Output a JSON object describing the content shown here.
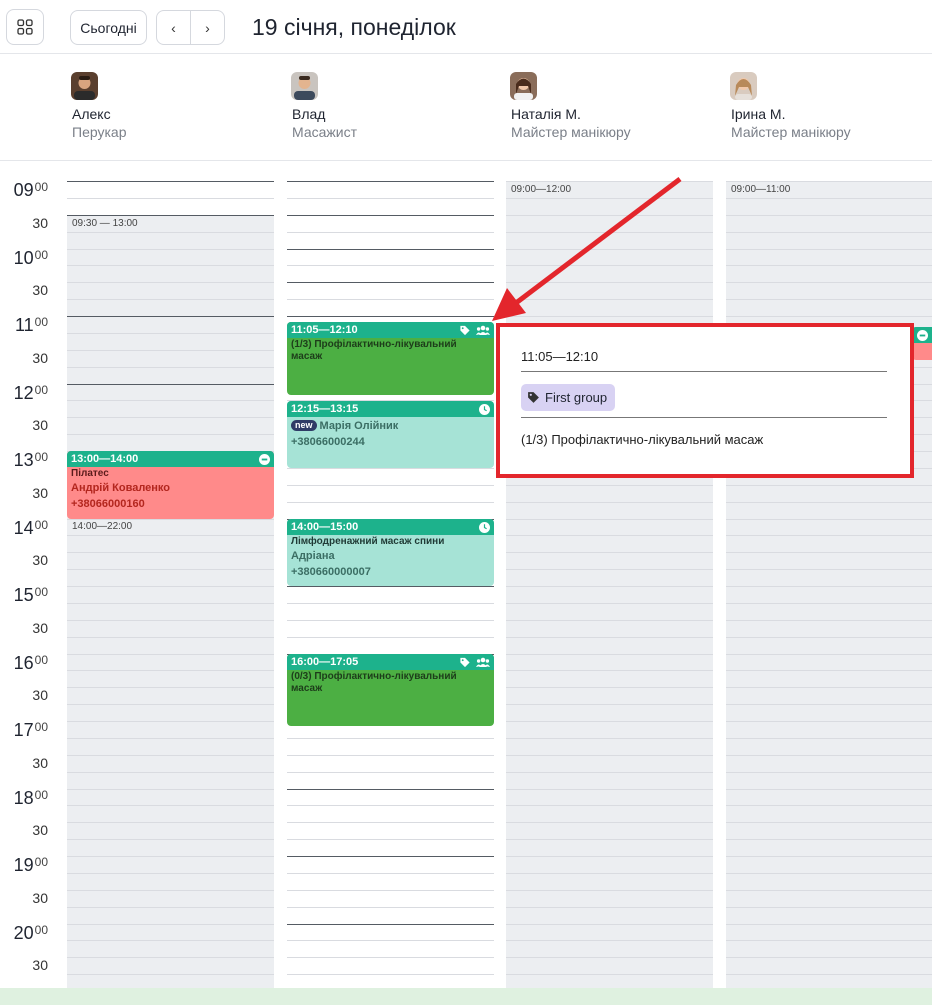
{
  "header": {
    "today_label": "Сьогодні",
    "prev_label": "‹",
    "next_label": "›",
    "date_title": "19 січня, понеділок"
  },
  "icons": {
    "grid": "grid-icon",
    "tag": "tag-icon",
    "group": "users-icon",
    "clock": "clock-icon",
    "minus": "minus-circle-icon",
    "arrow": "red-annotation-arrow"
  },
  "colors": {
    "accent_green": "#1db28c",
    "group_body": "#4caf43",
    "teal_body": "#a6e3d6",
    "red_body": "#ff8a8a",
    "highlight_red": "#e3262c",
    "tag_bg": "#d8d2f3"
  },
  "staff": [
    {
      "name": "Алекс",
      "role": "Перукар"
    },
    {
      "name": "Влад",
      "role": "Масажист"
    },
    {
      "name": "Наталія М.",
      "role": "Майстер манікюру"
    },
    {
      "name": "Ірина М.",
      "role": "Майстер манікюру"
    }
  ],
  "times": {
    "minutes_00": "00",
    "minutes_30": "30",
    "hours": [
      "09",
      "10",
      "11",
      "12",
      "13",
      "14",
      "15",
      "16",
      "17",
      "18",
      "19",
      "20"
    ]
  },
  "ranges": {
    "alex_1": "09:30 — 13:00",
    "alex_2": "14:00—22:00",
    "natalia": "09:00—12:00",
    "iryna": "09:00—11:00"
  },
  "appointments": {
    "alex_pilates": {
      "time": "13:00—14:00",
      "title": "Пілатес",
      "client": "Андрій Коваленко",
      "phone": "+38066000160"
    },
    "vlad_group1": {
      "time": "11:05—12:10",
      "title": "(1/3) Профілактично-лікувальний масаж"
    },
    "vlad_maria": {
      "time": "12:15—13:15",
      "badge": "new",
      "client": "Марія Олійник",
      "phone": "+38066000244"
    },
    "vlad_lymph": {
      "time": "14:00—15:00",
      "title": "Лімфодренажний масаж спини",
      "client": "Адріана",
      "phone": "+380660000007"
    },
    "vlad_group2": {
      "time": "16:00—17:05",
      "title": "(0/3) Профілактично-лікувальний масаж"
    }
  },
  "popover": {
    "time": "11:05—12:10",
    "tag": "First group",
    "description": "(1/3) Профілактично-лікувальний масаж"
  }
}
